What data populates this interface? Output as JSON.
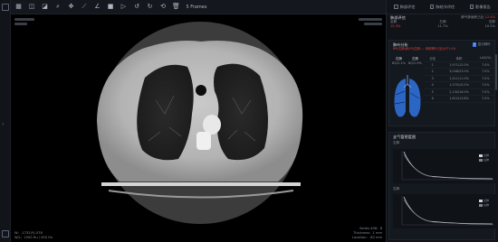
{
  "toolbar": {
    "icons": [
      "grid-icon",
      "save-icon",
      "window-level-icon",
      "zoom-icon",
      "pan-icon",
      "measure-icon",
      "angle-icon",
      "stop-icon",
      "play-icon",
      "rotate-left-icon",
      "rotate-right-icon",
      "reset-icon",
      "delete-icon"
    ],
    "label": "5 Frames"
  },
  "tabs": [
    {
      "label": "肺部评估",
      "checked": true
    },
    {
      "label": "肺结节评估",
      "checked": true
    },
    {
      "label": "影像报告",
      "checked": true
    }
  ],
  "viewer": {
    "bottom_left_1": "W：-1732(Y)-578",
    "bottom_left_2": "W/L：1500 Hu / 450 Hu",
    "bottom_right_1": "Series 406：8",
    "bottom_right_2": "Thickness：1 mm",
    "bottom_right_3": "Location：-82 mm"
  },
  "summary": {
    "title": "肺部评估",
    "right_header": "肺气肿面积占比",
    "right_value": "12.4%",
    "row1_left": "全肺",
    "row1_mid": "左肺",
    "row1_right": "右肺",
    "row2_left": "15.3%",
    "row2_mid": "11.7%",
    "row2_right": "10.5%"
  },
  "emphysema": {
    "title": "肺叶分析",
    "toggle_label": "显示肺叶",
    "alert": "RPI(右肺)和LPI(左肺) — 体积肺叶占比大于1.0%",
    "right_lung_label": "右肺",
    "left_lung_label": "左肺",
    "right_lung_value": "85/2.1%",
    "left_lung_value": "80/1.9%",
    "columns": [
      "分区",
      "体积",
      "LAA(%)"
    ],
    "rows": [
      [
        "1",
        "1,971/12.0%",
        "7.0%"
      ],
      [
        "2",
        "3,048/23.0%",
        "7.0%"
      ],
      [
        "3",
        "1,411/11.0%",
        "7.0%"
      ],
      [
        "4",
        "1,370/10.2%",
        "7.0%"
      ],
      [
        "5",
        "2,100/16.0%",
        "7.0%"
      ],
      [
        "6",
        "1,810/13.8%",
        "7.0%"
      ]
    ]
  },
  "density": {
    "title": "支气管密度图",
    "chart1_label": "右肺",
    "chart2_label": "右肺",
    "legend1": "全肺",
    "legend2": "右肺"
  },
  "colors": {
    "accent": "#3b82f6",
    "danger": "#e0433f",
    "lung_blue": "#2f6fd6"
  }
}
